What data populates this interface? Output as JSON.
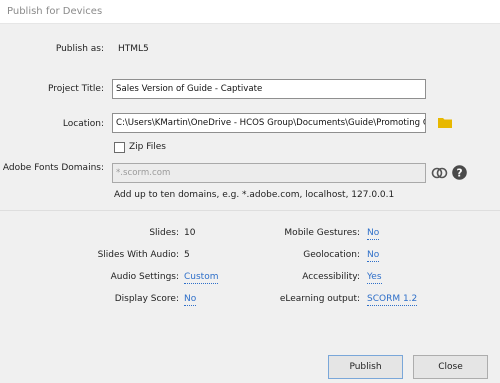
{
  "window": {
    "title": "Publish for Devices"
  },
  "publish_as": {
    "label": "Publish as:",
    "value": "HTML5"
  },
  "project_title": {
    "label": "Project Title:",
    "value": "Sales Version of Guide - Captivate"
  },
  "location": {
    "label": "Location:",
    "value": "C:\\Users\\KMartin\\OneDrive - HCOS Group\\Documents\\Guide\\Promoting Guide",
    "folder_icon": "folder-icon",
    "folder_color": "#e8b800"
  },
  "zip_files": {
    "label": "Zip Files",
    "checked": false
  },
  "fonts_domains": {
    "label": "Adobe Fonts Domains:",
    "placeholder": "*.scorm.com",
    "hint": "Add up to ten domains, e.g. *.adobe.com, localhost, 127.0.0.1"
  },
  "stats": {
    "slides": {
      "label": "Slides:",
      "value": "10"
    },
    "slides_with_audio": {
      "label": "Slides With Audio:",
      "value": "5"
    },
    "audio_settings": {
      "label": "Audio Settings:",
      "value": "Custom"
    },
    "display_score": {
      "label": "Display Score:",
      "value": "No"
    },
    "mobile_gestures": {
      "label": "Mobile Gestures:",
      "value": "No"
    },
    "geolocation": {
      "label": "Geolocation:",
      "value": "No"
    },
    "accessibility": {
      "label": "Accessibility:",
      "value": "Yes"
    },
    "elearning_output": {
      "label": "eLearning output:",
      "value": "SCORM 1.2"
    }
  },
  "buttons": {
    "publish": "Publish",
    "close": "Close"
  },
  "colors": {
    "link": "#2e6fc9",
    "background": "#f0f0f0"
  }
}
